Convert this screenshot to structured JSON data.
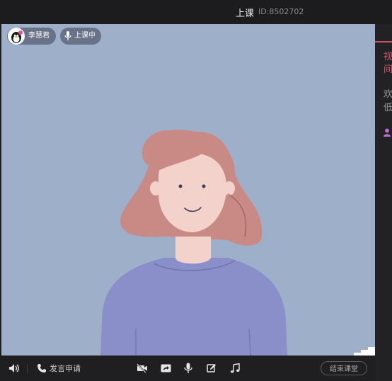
{
  "titlebar": {
    "title": "上课",
    "room_id": "ID:8502702"
  },
  "video": {
    "user_name": "李慧君",
    "status": "上课中"
  },
  "side_panel": {
    "title_fragment": "视间",
    "text_fragment": "欢低"
  },
  "toolbar": {
    "speaker_icon": "speaker-icon",
    "speak_request_label": "发言申请",
    "camera_icon": "camera-off-icon",
    "share_icon": "share-screen-icon",
    "mic_icon": "microphone-icon",
    "edit_icon": "edit-icon",
    "music_icon": "music-icon",
    "end_class_label": "结束课堂"
  },
  "colors": {
    "video_bg": "#9dafc9",
    "accent_red": "#d7536a",
    "bar_bg": "#1f1f21"
  }
}
